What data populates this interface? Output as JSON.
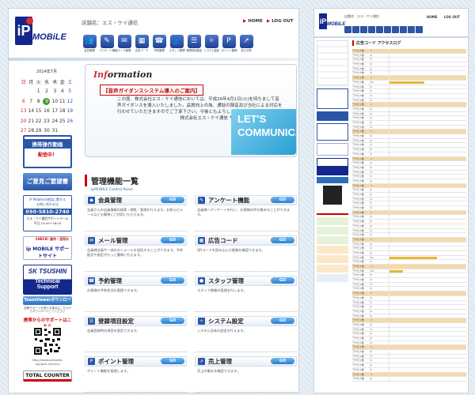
{
  "header": {
    "shop_name": "店舗名：エス・ケイ通信",
    "home_label": "HOME",
    "logout_label": "LOG OUT",
    "nav": [
      {
        "label": "会員管理",
        "icon": "people-icon",
        "glyph": "👥"
      },
      {
        "label": "アンケート機能",
        "icon": "pencil-icon",
        "glyph": "✎"
      },
      {
        "label": "メール管理",
        "icon": "mail-icon",
        "glyph": "✉"
      },
      {
        "label": "広告コード",
        "icon": "qr-code-icon",
        "glyph": "▦"
      },
      {
        "label": "予約管理",
        "icon": "phone-icon",
        "glyph": "☎"
      },
      {
        "label": "スタッフ管理",
        "icon": "staff-icon",
        "glyph": "👤"
      },
      {
        "label": "登録項目設定",
        "icon": "list-icon",
        "glyph": "☰"
      },
      {
        "label": "システム設定",
        "icon": "wrench-icon",
        "glyph": "✧"
      },
      {
        "label": "ポイント管理",
        "icon": "point-icon",
        "glyph": "P"
      },
      {
        "label": "売上分析",
        "icon": "chart-icon",
        "glyph": "↗"
      }
    ]
  },
  "calendar": {
    "caption": "2014年7月",
    "weekdays": [
      "日",
      "月",
      "火",
      "水",
      "木",
      "金",
      "土"
    ],
    "weeks": [
      [
        "",
        "",
        "1",
        "2",
        "3",
        "4",
        "5"
      ],
      [
        "6",
        "7",
        "8",
        "9",
        "10",
        "11",
        "12"
      ],
      [
        "13",
        "14",
        "15",
        "16",
        "17",
        "18",
        "19"
      ],
      [
        "20",
        "21",
        "22",
        "23",
        "24",
        "25",
        "26"
      ],
      [
        "27",
        "28",
        "29",
        "30",
        "31",
        "",
        ""
      ]
    ],
    "today": "9"
  },
  "sidebar": {
    "banner_video": "携帯操作動画",
    "banner_video_sub": "配信中！",
    "banner_request": "ご意見ご要望書",
    "phone_lead": "iP Mobileの使用に関する",
    "phone_lead2": "お問い合わせは",
    "phone_number": "050-5810-2740",
    "phone_company": "エス・ケイ通信サポートチーム",
    "phone_hours": "平日 10:00〜18:00",
    "check_label": "CHECK!",
    "support_site": "ip MOBILE サポートサイト",
    "support_sub": "操作・活用の",
    "sk_title": "SK TSUSHIN",
    "sk_sub": "Technical Support",
    "teamviewer": "TeamViewerダウンロード",
    "tv_note": "遠隔サポートを受ける場合はこちらからダウンロードしてください",
    "mobile_support": "携帯からのサポートはこちら",
    "support_url": "http://www.ipmobile-support.com/m/",
    "total_counter": "TOTAL COUNTER"
  },
  "information": {
    "title_left": "Inf",
    "title_right": "ormation",
    "headline": "【音声ガイダンスシステム導入のご案内】",
    "body": "この度、株式会社エス・ケイ通信においては、平成26年4月1日(火)を持ちまして音声ガイダンスを導入いたしました。品質向上の為、通話の録音及び当社による対応を行わせていただきますのでご了承下さい。今後ともよろしくお願い申し上げます。",
    "signature": "株式会社エス・ケイ通信 サポートチーム",
    "banner": "LET'S COMMUNICATION"
  },
  "control": {
    "title": "管理機能一覧",
    "subtitle": "ipMOBILE Control Panel",
    "go_label": "GO",
    "cards": [
      {
        "title": "会員管理",
        "icon": "people-icon",
        "desc": "会員さんの会員情報の検索・閲覧・管理を行えます。お知らせメールなども簡単にご利用いただけます。"
      },
      {
        "title": "アンケート機能",
        "icon": "pencil-icon",
        "desc": "会員様へアンケートを行い、お客様の声を集めることができます。"
      },
      {
        "title": "メール管理",
        "icon": "mail-icon",
        "desc": "会員様全員や一部の方へメールを送信することができます。予約配信や設定がもっと簡単に行えます。"
      },
      {
        "title": "広告コード",
        "icon": "qr-code-icon",
        "desc": "QRコードを読み込んだ経路を確認できます。"
      },
      {
        "title": "予約管理",
        "icon": "phone-icon",
        "desc": "お客様の予約状況を管理できます。"
      },
      {
        "title": "スタッフ管理",
        "icon": "staff-icon",
        "desc": "スタッフ情報の管理を行います。"
      },
      {
        "title": "登録項目設定",
        "icon": "list-icon",
        "desc": "会員登録時の項目を設定できます。"
      },
      {
        "title": "システム設定",
        "icon": "wrench-icon",
        "desc": "システム全体の設定を行えます。"
      },
      {
        "title": "ポイント管理",
        "icon": "point-icon",
        "desc": "ポイント機能を管理します。"
      },
      {
        "title": "売上管理",
        "icon": "chart-icon",
        "desc": "売上の集計を確認できます。"
      }
    ]
  },
  "page2": {
    "shop_name": "店舗名：エス・ケイ通信",
    "home_label": "HOME",
    "logout_label": "LOG OUT",
    "section_title": "広告コード アクセスログ",
    "rows": [
      {
        "a": "アクセス数",
        "b": "0",
        "v": 0.0
      },
      {
        "a": "アクセス数",
        "b": "0",
        "v": 0.0
      },
      {
        "a": "アクセス数",
        "b": "0",
        "v": 0.0
      },
      {
        "a": "アクセス数",
        "b": "0",
        "v": 0.0
      },
      {
        "a": "アクセス数",
        "b": "0",
        "v": 0.0
      },
      {
        "a": "アクセス数",
        "b": "0",
        "v": 0.0
      },
      {
        "a": "アクセス数",
        "b": "0",
        "v": 0.0
      },
      {
        "a": "アクセス数",
        "b": "45",
        "v": 0.45
      },
      {
        "a": "アクセス数",
        "b": "0",
        "v": 0.0
      },
      {
        "a": "アクセス数",
        "b": "0",
        "v": 0.0
      },
      {
        "a": "アクセス数",
        "b": "0",
        "v": 0.0
      },
      {
        "a": "アクセス数",
        "b": "0",
        "v": 0.0
      },
      {
        "a": "アクセス数",
        "b": "0",
        "v": 0.0
      },
      {
        "a": "アクセス数",
        "b": "0",
        "v": 0.0
      },
      {
        "a": "アクセス数",
        "b": "0",
        "v": 0.0
      },
      {
        "a": "アクセス数",
        "b": "0",
        "v": 0.0
      },
      {
        "a": "アクセス数",
        "b": "0",
        "v": 0.0
      },
      {
        "a": "アクセス数",
        "b": "0",
        "v": 0.0
      },
      {
        "a": "アクセス数",
        "b": "0",
        "v": 0.0
      },
      {
        "a": "アクセス数",
        "b": "0",
        "v": 0.0
      },
      {
        "a": "アクセス数",
        "b": "0",
        "v": 0.0
      },
      {
        "a": "アクセス数",
        "b": "0",
        "v": 0.0
      },
      {
        "a": "アクセス数",
        "b": "0",
        "v": 0.0
      },
      {
        "a": "アクセス数",
        "b": "0",
        "v": 0.0
      },
      {
        "a": "アクセス数",
        "b": "0",
        "v": 0.0
      },
      {
        "a": "アクセス数",
        "b": "0",
        "v": 0.0
      },
      {
        "a": "アクセス数",
        "b": "0",
        "v": 0.0
      },
      {
        "a": "アクセス数",
        "b": "0",
        "v": 0.0
      },
      {
        "a": "アクセス数",
        "b": "0",
        "v": 0.0
      },
      {
        "a": "アクセス数",
        "b": "0",
        "v": 0.0
      },
      {
        "a": "アクセス数",
        "b": "0",
        "v": 0.0
      },
      {
        "a": "アクセス数",
        "b": "0",
        "v": 0.0
      },
      {
        "a": "アクセス数",
        "b": "0",
        "v": 0.0
      },
      {
        "a": "アクセス数",
        "b": "0",
        "v": 0.0
      },
      {
        "a": "アクセス数",
        "b": "0",
        "v": 0.0
      },
      {
        "a": "アクセス数",
        "b": "0",
        "v": 0.0
      },
      {
        "a": "アクセス数",
        "b": "0",
        "v": 0.0
      },
      {
        "a": "アクセス数",
        "b": "0",
        "v": 0.0
      },
      {
        "a": "アクセス数",
        "b": "0",
        "v": 0.0
      },
      {
        "a": "アクセス数",
        "b": "0",
        "v": 0.0
      },
      {
        "a": "アクセス数",
        "b": "0",
        "v": 0.0
      },
      {
        "a": "アクセス数",
        "b": "0",
        "v": 0.0
      },
      {
        "a": "アクセス数",
        "b": "0",
        "v": 0.0
      },
      {
        "a": "アクセス数",
        "b": "0",
        "v": 0.0
      },
      {
        "a": "アクセス数",
        "b": "0",
        "v": 0.0
      },
      {
        "a": "アクセス数",
        "b": "0",
        "v": 0.0
      },
      {
        "a": "アクセス数",
        "b": "62",
        "v": 0.62
      },
      {
        "a": "アクセス数",
        "b": "0",
        "v": 0.0
      },
      {
        "a": "アクセス数",
        "b": "0",
        "v": 0.0
      },
      {
        "a": "アクセス数",
        "b": "18",
        "v": 0.18
      },
      {
        "a": "アクセス数",
        "b": "0",
        "v": 0.0
      },
      {
        "a": "アクセス数",
        "b": "0",
        "v": 0.0
      },
      {
        "a": "アクセス数",
        "b": "0",
        "v": 0.0
      },
      {
        "a": "アクセス数",
        "b": "0",
        "v": 0.0
      },
      {
        "a": "アクセス数",
        "b": "0",
        "v": 0.0
      },
      {
        "a": "アクセス数",
        "b": "0",
        "v": 0.0
      },
      {
        "a": "アクセス数",
        "b": "0",
        "v": 0.0
      },
      {
        "a": "アクセス数",
        "b": "0",
        "v": 0.0
      },
      {
        "a": "アクセス数",
        "b": "0",
        "v": 0.0
      },
      {
        "a": "アクセス数",
        "b": "0",
        "v": 0.0
      },
      {
        "a": "アクセス数",
        "b": "0",
        "v": 0.0
      },
      {
        "a": "アクセス数",
        "b": "0",
        "v": 0.0
      },
      {
        "a": "アクセス数",
        "b": "0",
        "v": 0.0
      },
      {
        "a": "アクセス数",
        "b": "0",
        "v": 0.0
      },
      {
        "a": "アクセス数",
        "b": "0",
        "v": 0.0
      },
      {
        "a": "アクセス数",
        "b": "0",
        "v": 0.0
      },
      {
        "a": "アクセス数",
        "b": "0",
        "v": 0.0
      },
      {
        "a": "アクセス数",
        "b": "0",
        "v": 0.0
      },
      {
        "a": "アクセス数",
        "b": "0",
        "v": 0.0
      },
      {
        "a": "アクセス数",
        "b": "0",
        "v": 0.0
      },
      {
        "a": "アクセス数",
        "b": "0",
        "v": 0.0
      },
      {
        "a": "アクセス数",
        "b": "0",
        "v": 0.0
      },
      {
        "a": "アクセス数",
        "b": "0",
        "v": 0.0
      },
      {
        "a": "アクセス数",
        "b": "0",
        "v": 0.0
      },
      {
        "a": "アクセス数",
        "b": "0",
        "v": 0.0
      },
      {
        "a": "アクセス数",
        "b": "0",
        "v": 0.0
      }
    ]
  },
  "colors": {
    "brand": "#13288a",
    "accent": "#c00000",
    "button": "#2b80d0",
    "bar": "#e8b830"
  }
}
